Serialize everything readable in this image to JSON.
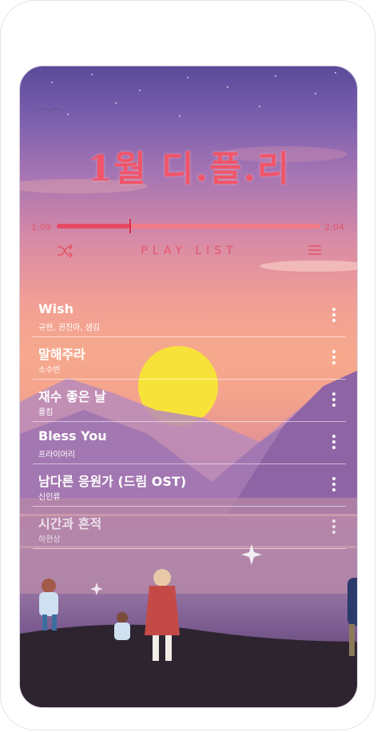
{
  "header": {
    "title": "1월 디.플.리"
  },
  "player": {
    "current_time": "1:09",
    "total_time": "2:04",
    "progress_fraction": 0.28,
    "playlist_label": "PLAY LIST"
  },
  "icons": {
    "shuffle": "shuffle-icon",
    "menu": "menu-icon",
    "more": "more-vertical-icon"
  },
  "colors": {
    "accent": "#e64a63",
    "track_text": "#ffffff"
  },
  "tracks": [
    {
      "title": "Wish",
      "artist": "규현, 권진아, 샘김"
    },
    {
      "title": "말해주라",
      "artist": "소수빈"
    },
    {
      "title": "재수 좋은 날",
      "artist": "폴킴"
    },
    {
      "title": "Bless You",
      "artist": "프라이머리"
    },
    {
      "title": "남다른 응원가 (드림 OST)",
      "artist": "신인류"
    },
    {
      "title": "시간과 흔적",
      "artist": "하현상"
    }
  ]
}
